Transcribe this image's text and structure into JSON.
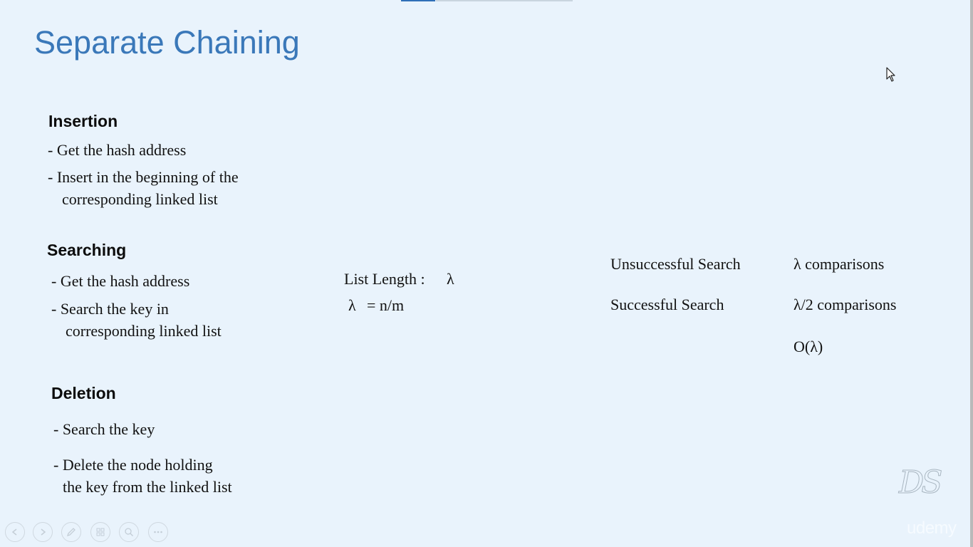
{
  "slide": {
    "title": "Separate Chaining",
    "insertion": {
      "heading": "Insertion",
      "lines": [
        "- Get the hash address",
        "- Insert in the beginning of the",
        "corresponding linked list"
      ]
    },
    "searching": {
      "heading": "Searching",
      "lines": [
        "- Get the hash address",
        "- Search the key in",
        "corresponding linked list"
      ]
    },
    "deletion": {
      "heading": "Deletion",
      "lines": [
        "- Search the key",
        "- Delete the node holding",
        "the key from the linked list"
      ]
    },
    "list_length": {
      "label": "List Length :",
      "symbol": "λ",
      "formula_symbol": "λ",
      "formula": "= n/m"
    },
    "complexity": {
      "unsuccessful_label": "Unsuccessful Search",
      "unsuccessful_value": "λ comparisons",
      "successful_label": "Successful Search",
      "successful_value": "λ/2 comparisons",
      "big_o": "O(λ)"
    }
  },
  "branding": {
    "logo_text": "DS",
    "watermark": "udemy"
  },
  "icons": {
    "cursor": "mouse-pointer-icon",
    "controls": [
      "previous-icon",
      "next-icon",
      "pen-icon",
      "slides-icon",
      "zoom-icon",
      "more-icon"
    ]
  },
  "colors": {
    "background": "#e9f3fc",
    "title": "#3a78b9",
    "accent": "#2f6fb8"
  }
}
